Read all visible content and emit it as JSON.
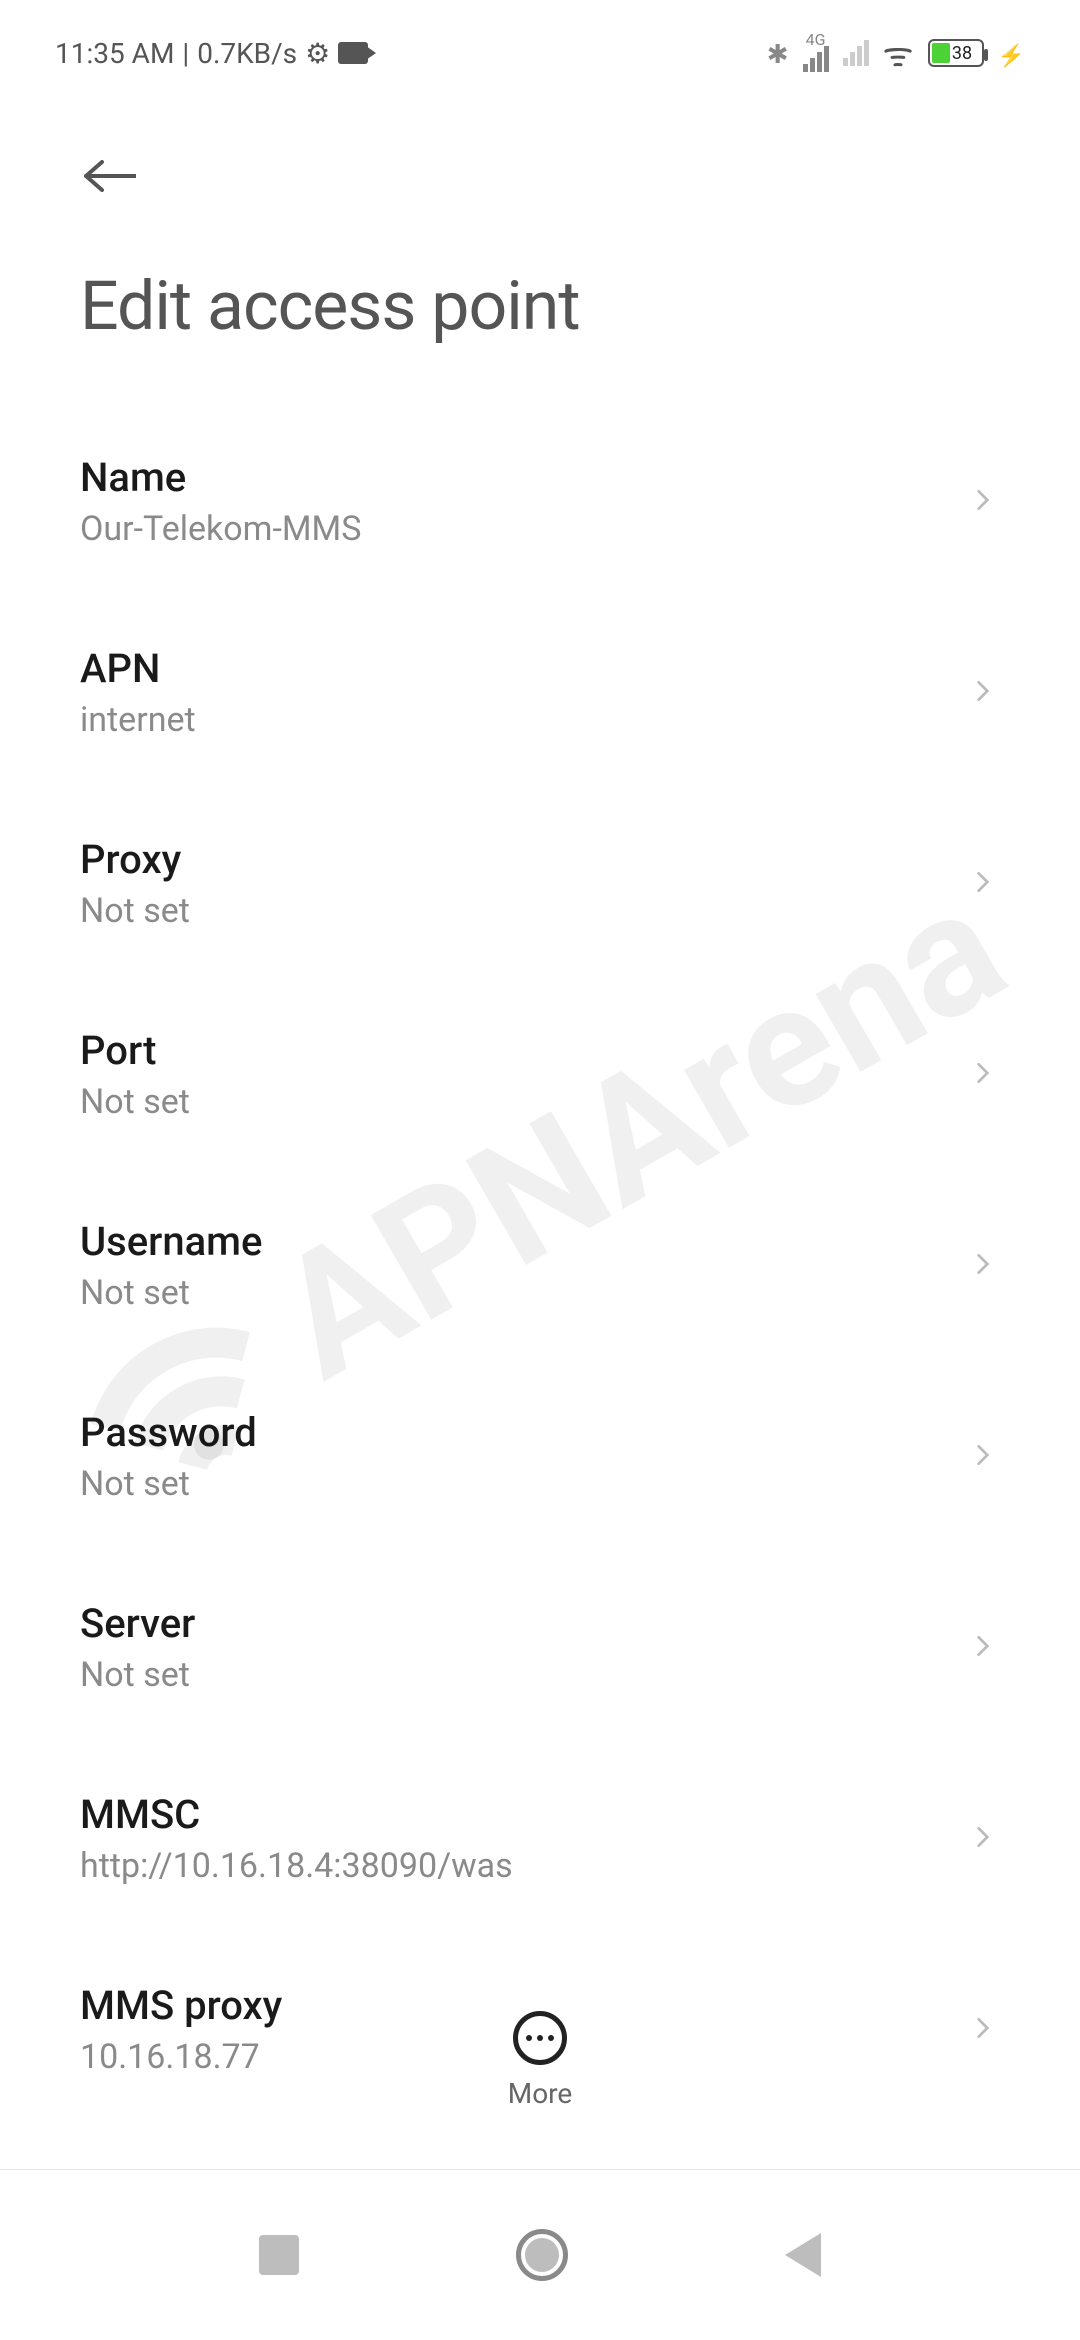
{
  "status": {
    "time": "11:35 AM",
    "separator": "|",
    "rate": "0.7KB/s",
    "net_label": "4G",
    "battery_pct": "38"
  },
  "header": {
    "title": "Edit access point"
  },
  "settings": [
    {
      "label": "Name",
      "value": "Our-Telekom-MMS"
    },
    {
      "label": "APN",
      "value": "internet"
    },
    {
      "label": "Proxy",
      "value": "Not set"
    },
    {
      "label": "Port",
      "value": "Not set"
    },
    {
      "label": "Username",
      "value": "Not set"
    },
    {
      "label": "Password",
      "value": "Not set"
    },
    {
      "label": "Server",
      "value": "Not set"
    },
    {
      "label": "MMSC",
      "value": "http://10.16.18.4:38090/was"
    },
    {
      "label": "MMS proxy",
      "value": "10.16.18.77"
    }
  ],
  "footer": {
    "more_label": "More"
  },
  "watermark": "APNArena"
}
